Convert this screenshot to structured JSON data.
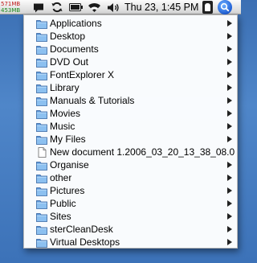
{
  "menubar": {
    "memory": {
      "used": "571MB",
      "free": "453MB"
    },
    "icons": [
      "chat-icon",
      "sync-icon",
      "battery-icon",
      "wifi-icon",
      "volume-icon"
    ],
    "clock": "Thu 23, 1:45 PM",
    "user_icon": "user-icon",
    "spotlight_icon": "spotlight-search-icon"
  },
  "menu": {
    "items": [
      {
        "label": "Applications",
        "icon": "folder",
        "submenu": true
      },
      {
        "label": "Desktop",
        "icon": "folder",
        "submenu": true
      },
      {
        "label": "Documents",
        "icon": "folder",
        "submenu": true
      },
      {
        "label": "DVD Out",
        "icon": "folder",
        "submenu": true
      },
      {
        "label": "FontExplorer X",
        "icon": "folder",
        "submenu": true
      },
      {
        "label": "Library",
        "icon": "folder",
        "submenu": true
      },
      {
        "label": "Manuals & Tutorials",
        "icon": "folder",
        "submenu": true
      },
      {
        "label": "Movies",
        "icon": "folder",
        "submenu": true
      },
      {
        "label": "Music",
        "icon": "folder",
        "submenu": true
      },
      {
        "label": "My Files",
        "icon": "folder",
        "submenu": true
      },
      {
        "label": "New document 1.2006_03_20_13_38_08.0",
        "icon": "document",
        "submenu": false
      },
      {
        "label": "Organise",
        "icon": "folder",
        "submenu": true
      },
      {
        "label": "other",
        "icon": "folder",
        "submenu": true
      },
      {
        "label": "Pictures",
        "icon": "folder",
        "submenu": true
      },
      {
        "label": "Public",
        "icon": "folder",
        "submenu": true
      },
      {
        "label": "Sites",
        "icon": "folder",
        "submenu": true
      },
      {
        "label": "sterCleanDesk",
        "icon": "folder",
        "submenu": true
      },
      {
        "label": "Virtual Desktops",
        "icon": "folder",
        "submenu": true
      }
    ]
  },
  "colors": {
    "desktop": "#3f75bb",
    "folder": "#79aee6",
    "memory_used": "#c01818",
    "memory_free": "#1a8a1a"
  }
}
